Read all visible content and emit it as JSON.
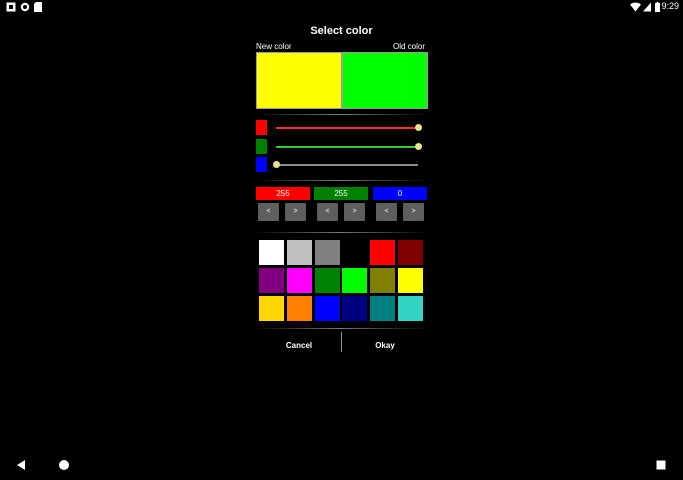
{
  "status_bar": {
    "time": "9:29",
    "left_icons": [
      "notification-square-icon",
      "circle-icon",
      "sd-card-icon"
    ],
    "right_icons": [
      "wifi-icon",
      "signal-icon",
      "battery-icon"
    ]
  },
  "dialog": {
    "title": "Select color",
    "new_color_label": "New color",
    "old_color_label": "Old color",
    "new_color": "#ffff00",
    "old_color": "#00ff00",
    "sliders": [
      {
        "channel": "red",
        "color": "#ff0000",
        "value": 255,
        "max": 255
      },
      {
        "channel": "green",
        "color": "#008000",
        "value": 255,
        "max": 255
      },
      {
        "channel": "blue",
        "color": "#0000ff",
        "value": 0,
        "max": 255
      }
    ],
    "values": {
      "red": "255",
      "green": "255",
      "blue": "0"
    },
    "dec_label": "<",
    "inc_label": ">",
    "palette": [
      [
        "#ffffff",
        "#c0c0c0",
        "#808080",
        "#000000",
        "#ff0000",
        "#800000"
      ],
      [
        "#800080",
        "#ff00ff",
        "#008000",
        "#00ff00",
        "#808000",
        "#ffff00"
      ],
      [
        "#ffd700",
        "#ff8000",
        "#0000ff",
        "#000080",
        "#008080",
        "#30d5c8"
      ]
    ],
    "cancel_label": "Cancel",
    "okay_label": "Okay"
  },
  "nav_bar": {
    "icons": [
      "back-icon",
      "home-icon",
      "recents-icon"
    ]
  }
}
